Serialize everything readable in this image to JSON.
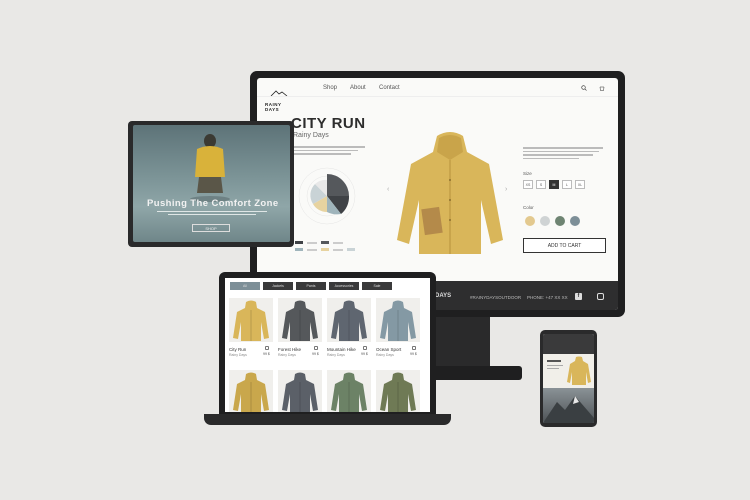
{
  "monitor": {
    "brand": "RAINY DAYS",
    "nav": [
      "Shop",
      "About",
      "Contact"
    ],
    "product_title": "CITY RUN",
    "product_subtitle": "Rainy Days",
    "size_label": "Size",
    "sizes": [
      "XS",
      "S",
      "M",
      "L",
      "XL"
    ],
    "color_label": "Color",
    "swatch_colors": [
      "#e3c98f",
      "#cfd3d4",
      "#6e8472",
      "#7d8f98"
    ],
    "add_to_cart": "ADD TO CART",
    "footer_brand": "DAYS",
    "footer_links": [
      "#RAINYDAYSOUTDOOR",
      "PHONE: +47 XX XX"
    ]
  },
  "tablet": {
    "hero_title": "Pushing The Comfort Zone",
    "hero_button": "SHOP"
  },
  "laptop": {
    "filter_tabs": [
      "All",
      "Jackets",
      "Pants",
      "Accessories",
      "Sale"
    ],
    "products": [
      {
        "name": "City Run",
        "brand": "Rainy Days",
        "price": "99 $",
        "color": "#d9b65a"
      },
      {
        "name": "Forest Hike",
        "brand": "Rainy Days",
        "price": "99 $",
        "color": "#55585b"
      },
      {
        "name": "Mountain Hike",
        "brand": "Rainy Days",
        "price": "99 $",
        "color": "#5f6670"
      },
      {
        "name": "Ocean Sport",
        "brand": "Rainy Days",
        "price": "99 $",
        "color": "#8499a4"
      },
      {
        "name": "",
        "brand": "",
        "price": "",
        "color": "#c9a74c"
      },
      {
        "name": "",
        "brand": "",
        "price": "",
        "color": "#5b6068"
      },
      {
        "name": "",
        "brand": "",
        "price": "",
        "color": "#6c8266"
      },
      {
        "name": "",
        "brand": "",
        "price": "",
        "color": "#6f7a55"
      }
    ]
  }
}
